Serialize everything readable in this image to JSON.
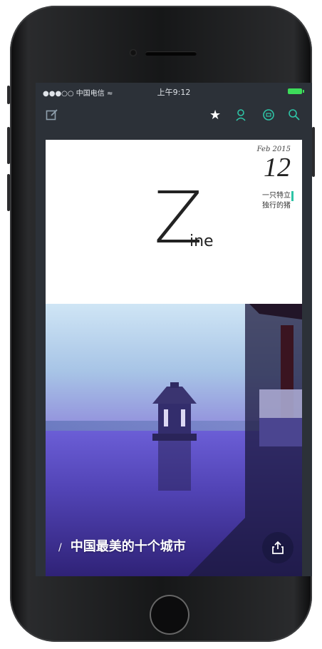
{
  "status_bar": {
    "carrier": "●●●○○ 中国电信 ≈",
    "time": "上午9:12"
  },
  "nav": {
    "compose_icon": "edit-icon",
    "tabs": [
      {
        "icon": "star-icon",
        "active": true
      },
      {
        "icon": "user-icon",
        "active": false
      },
      {
        "icon": "message-icon",
        "active": false
      },
      {
        "icon": "search-icon",
        "active": false
      }
    ]
  },
  "cover": {
    "month": "Feb 2015",
    "day": "12",
    "tagline_line1": "一只特立",
    "tagline_line2": "独行的猪",
    "logo_main": "Z",
    "logo_sub": "ine",
    "caption_slash": "/",
    "caption": "中国最美的十个城市",
    "share_icon": "share-icon"
  },
  "colors": {
    "accent": "#2ec4a6",
    "bar_bg": "#2c3138"
  }
}
